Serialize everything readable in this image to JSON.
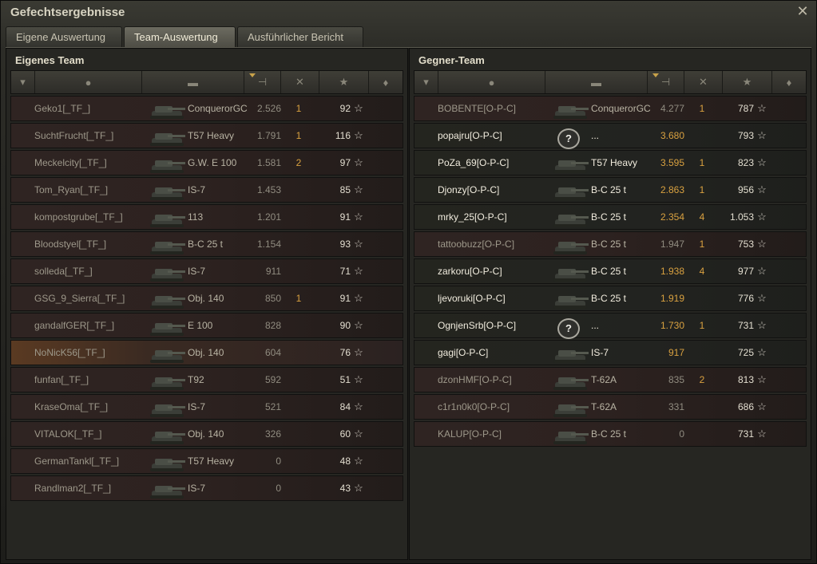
{
  "window": {
    "title": "Gefechtsergebnisse",
    "close_icon": "close-icon"
  },
  "tabs": [
    {
      "label": "Eigene Auswertung",
      "active": false
    },
    {
      "label": "Team-Auswertung",
      "active": true
    },
    {
      "label": "Ausführlicher Bericht",
      "active": false
    }
  ],
  "header_icons": [
    "squad-icon",
    "player-icon",
    "tank-icon",
    "damage-icon",
    "kills-icon",
    "xp-star-icon",
    "medal-icon"
  ],
  "left_team": {
    "title": "Eigenes Team",
    "rows": [
      {
        "name": "Geko1[_TF_]",
        "tank": "ConquerorGC",
        "damage": "2.526",
        "kills": "1",
        "xp": "92",
        "state": "dead"
      },
      {
        "name": "SuchtFrucht[_TF_]",
        "tank": "T57 Heavy",
        "damage": "1.791",
        "kills": "1",
        "xp": "116",
        "state": "dead"
      },
      {
        "name": "Meckelcity[_TF_]",
        "tank": "G.W. E 100",
        "damage": "1.581",
        "kills": "2",
        "xp": "97",
        "state": "dead"
      },
      {
        "name": "Tom_Ryan[_TF_]",
        "tank": "IS-7",
        "damage": "1.453",
        "kills": "",
        "xp": "85",
        "state": "dead"
      },
      {
        "name": "kompostgrube[_TF_]",
        "tank": "113",
        "damage": "1.201",
        "kills": "",
        "xp": "91",
        "state": "dead"
      },
      {
        "name": "Bloodstyel[_TF_]",
        "tank": "B-C 25 t",
        "damage": "1.154",
        "kills": "",
        "xp": "93",
        "state": "dead"
      },
      {
        "name": "solleda[_TF_]",
        "tank": "IS-7",
        "damage": "911",
        "kills": "",
        "xp": "71",
        "state": "dead"
      },
      {
        "name": "GSG_9_Sierra[_TF_]",
        "tank": "Obj. 140",
        "damage": "850",
        "kills": "1",
        "xp": "91",
        "state": "dead"
      },
      {
        "name": "gandalfGER[_TF_]",
        "tank": "E 100",
        "damage": "828",
        "kills": "",
        "xp": "90",
        "state": "dead"
      },
      {
        "name": "NoNicK56[_TF_]",
        "tank": "Obj. 140",
        "damage": "604",
        "kills": "",
        "xp": "76",
        "state": "self"
      },
      {
        "name": "funfan[_TF_]",
        "tank": "T92",
        "damage": "592",
        "kills": "",
        "xp": "51",
        "state": "dead"
      },
      {
        "name": "KraseOma[_TF_]",
        "tank": "IS-7",
        "damage": "521",
        "kills": "",
        "xp": "84",
        "state": "dead"
      },
      {
        "name": "VITALOK[_TF_]",
        "tank": "Obj. 140",
        "damage": "326",
        "kills": "",
        "xp": "60",
        "state": "dead"
      },
      {
        "name": "GermanTankl[_TF_]",
        "tank": "T57 Heavy",
        "damage": "0",
        "kills": "",
        "xp": "48",
        "state": "dead"
      },
      {
        "name": "Randlman2[_TF_]",
        "tank": "IS-7",
        "damage": "0",
        "kills": "",
        "xp": "43",
        "state": "dead"
      }
    ]
  },
  "right_team": {
    "title": "Gegner-Team",
    "rows": [
      {
        "name": "BOBENTE[O-P-C]",
        "tank": "ConquerorGC",
        "damage": "4.277",
        "kills": "1",
        "xp": "787",
        "state": "dead"
      },
      {
        "name": "popajru[O-P-C]",
        "tank": "...",
        "damage": "3.680",
        "kills": "",
        "xp": "793",
        "state": "alive",
        "unknown": true
      },
      {
        "name": "PoZa_69[O-P-C]",
        "tank": "T57 Heavy",
        "damage": "3.595",
        "kills": "1",
        "xp": "823",
        "state": "alive"
      },
      {
        "name": "Djonzy[O-P-C]",
        "tank": "B-C 25 t",
        "damage": "2.863",
        "kills": "1",
        "xp": "956",
        "state": "alive"
      },
      {
        "name": "mrky_25[O-P-C]",
        "tank": "B-C 25 t",
        "damage": "2.354",
        "kills": "4",
        "xp": "1.053",
        "state": "alive"
      },
      {
        "name": "tattoobuzz[O-P-C]",
        "tank": "B-C 25 t",
        "damage": "1.947",
        "kills": "1",
        "xp": "753",
        "state": "dead"
      },
      {
        "name": "zarkoru[O-P-C]",
        "tank": "B-C 25 t",
        "damage": "1.938",
        "kills": "4",
        "xp": "977",
        "state": "alive"
      },
      {
        "name": "ljevoruki[O-P-C]",
        "tank": "B-C 25 t",
        "damage": "1.919",
        "kills": "",
        "xp": "776",
        "state": "alive"
      },
      {
        "name": "OgnjenSrb[O-P-C]",
        "tank": "...",
        "damage": "1.730",
        "kills": "1",
        "xp": "731",
        "state": "alive",
        "unknown": true
      },
      {
        "name": "gagi[O-P-C]",
        "tank": "IS-7",
        "damage": "917",
        "kills": "",
        "xp": "725",
        "state": "alive"
      },
      {
        "name": "dzonHMF[O-P-C]",
        "tank": "T-62A",
        "damage": "835",
        "kills": "2",
        "xp": "813",
        "state": "dead"
      },
      {
        "name": "c1r1n0k0[O-P-C]",
        "tank": "T-62A",
        "damage": "331",
        "kills": "",
        "xp": "686",
        "state": "dead"
      },
      {
        "name": "KALUP[O-P-C]",
        "tank": "B-C 25 t",
        "damage": "0",
        "kills": "",
        "xp": "731",
        "state": "dead"
      }
    ]
  },
  "unknown_tank_glyph": "?",
  "star_glyph": "☆"
}
